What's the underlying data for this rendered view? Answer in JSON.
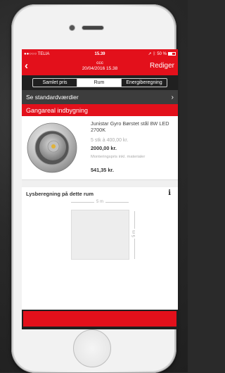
{
  "status_bar": {
    "carrier": "●●○○○ TELIA",
    "time": "15.39",
    "battery_text": "50 %"
  },
  "nav": {
    "title_line1": "ccc",
    "title_line2": "20/04/2016 15.38",
    "edit_label": "Rediger"
  },
  "segments": [
    {
      "label": "Samlet pris",
      "active": false
    },
    {
      "label": "Rum",
      "active": true
    },
    {
      "label": "Energiberegning",
      "active": false
    }
  ],
  "standard_row": {
    "label": "Se standardværdier"
  },
  "section": {
    "title": "Gangareal indbygning"
  },
  "product": {
    "name": "Junistar Gyro Børstet stål 8W LED 2700K",
    "qty_price": "5 stk à 400,00 kr.",
    "total": "2000,00 kr.",
    "mount_label": "Monteringspris inkl. materialer",
    "mount_value": "541,35 kr."
  },
  "lighting": {
    "title": "Lysberegning på dette rum",
    "info_glyph": "i",
    "width_label": "5 m",
    "height_label": "5 m"
  },
  "colors": {
    "accent": "#e3101b",
    "dark": "#202020"
  }
}
